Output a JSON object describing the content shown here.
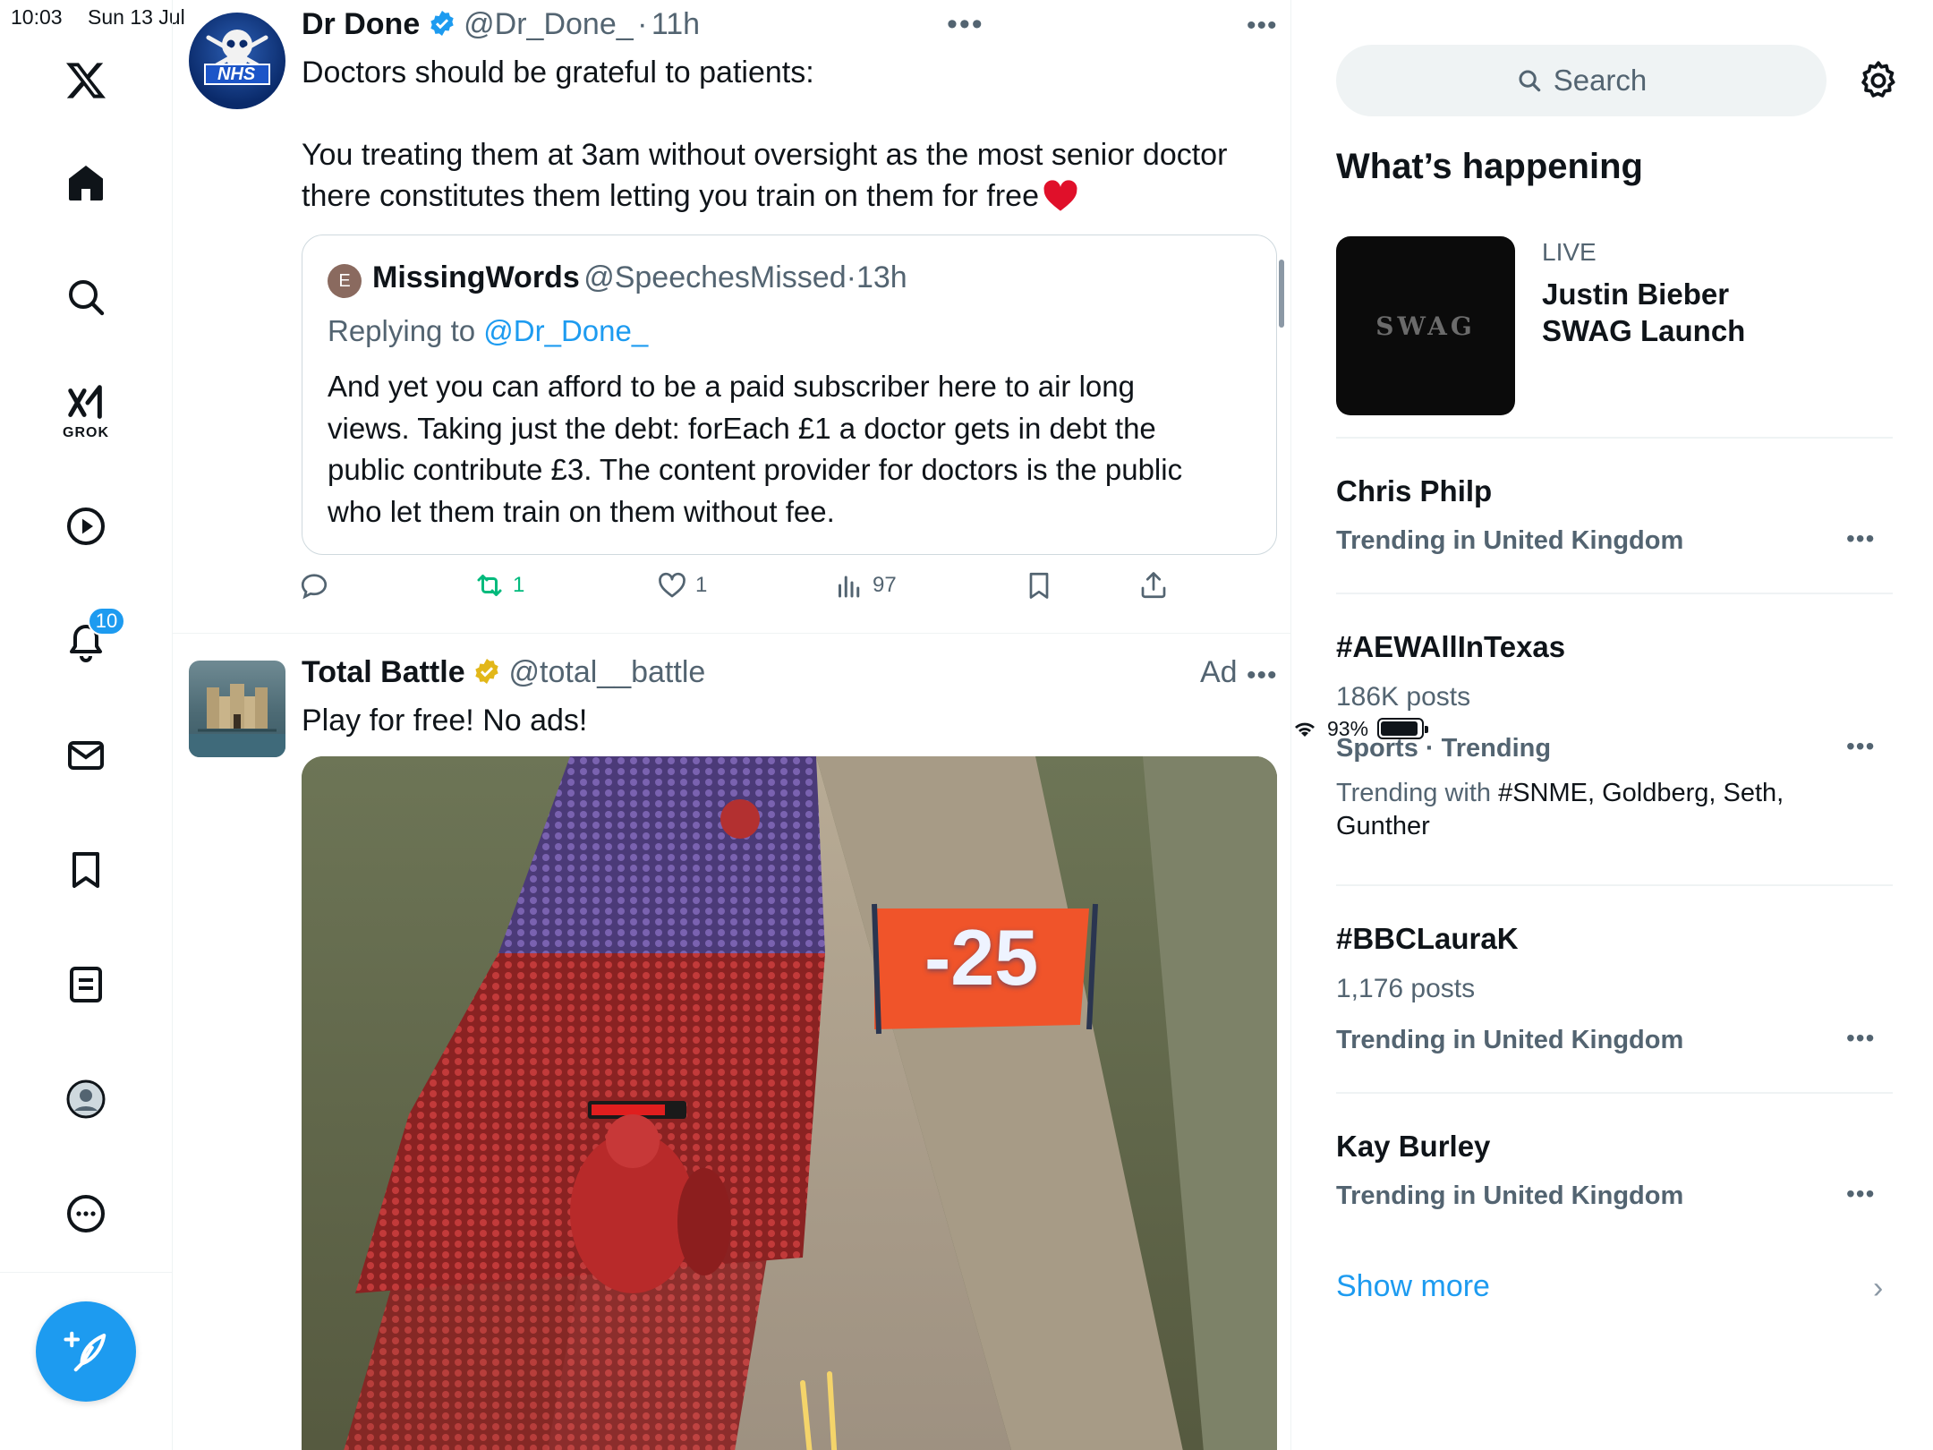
{
  "status_bar": {
    "time": "10:03",
    "date": "Sun 13 Jul",
    "battery": "93%",
    "battery_level": 0.93
  },
  "nav": {
    "grok_label": "GROK",
    "notification_count": "10",
    "icons": [
      "x-logo-icon",
      "home-icon",
      "search-icon",
      "grok-icon",
      "video-icon",
      "bell-icon",
      "mail-icon",
      "bookmark-icon",
      "lists-icon",
      "profile-icon",
      "more-icon",
      "compose-icon"
    ]
  },
  "tweet1": {
    "name": "Dr Done",
    "handle": "@Dr_Done_",
    "time": "11h",
    "line1": "Doctors should be grateful to patients:",
    "line2": "You treating them at 3am without oversight as the most senior doctor",
    "line3": "there constitutes them letting you train on them for free",
    "emoji": "❤️",
    "avatar_text": "NHS",
    "quote": {
      "initial": "E",
      "name": "MissingWords",
      "handle": "@SpeechesMissed",
      "time": "13h",
      "replying_prefix": "Replying to",
      "replying_handle": "@Dr_Done_",
      "lines": [
        "And yet you can afford to be a paid subscriber here to air long",
        "views.  Taking just the debt: forEach £1 a doctor gets in debt the",
        "public contribute £3.  The content provider for doctors is the public",
        "who let them train on them without fee."
      ]
    },
    "stats": {
      "reposts": "1",
      "likes": "1",
      "views": "97"
    }
  },
  "tweet2": {
    "name": "Total Battle",
    "handle": "@total__battle",
    "ad_label": "Ad",
    "text": "Play for free! No ads!",
    "video_text": "-25"
  },
  "sidebar": {
    "search_placeholder": "Search",
    "section_title": "What’s happening",
    "live": {
      "label": "LIVE",
      "title_line1": "Justin Bieber",
      "title_line2": "SWAG Launch",
      "card_text": "SWAG"
    },
    "trends": [
      {
        "title": "Chris Philp",
        "meta": "Trending in United Kingdom"
      },
      {
        "title": "#AEWAllInTexas",
        "posts": "186K posts",
        "meta": "Sports · Trending",
        "with_prefix": "Trending with",
        "with_tags": "#SNME, Goldberg, Seth,",
        "with_tags2": "Gunther"
      },
      {
        "title": "#BBCLauraK",
        "posts": "1,176 posts",
        "meta": "Trending in United Kingdom"
      },
      {
        "title": "Kay Burley",
        "meta": "Trending in United Kingdom"
      }
    ],
    "show_more": "Show more"
  },
  "colors": {
    "accent": "#1d9bf0",
    "repost_active": "#00ba7c",
    "text": "#0f1419",
    "muted": "#536471"
  }
}
